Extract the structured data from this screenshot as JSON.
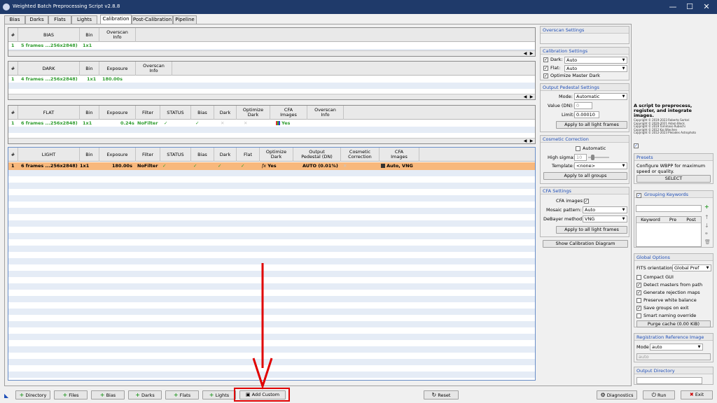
{
  "window": {
    "title": "Weighted Batch Preprocessing Script v2.8.8",
    "minimize": "—",
    "maximize": "☐",
    "close": "✕"
  },
  "tabs": [
    "Bias",
    "Darks",
    "Flats",
    "Lights",
    "Calibration",
    "Post-Calibration",
    "Pipeline"
  ],
  "active_tab": "Calibration",
  "bias_table": {
    "headers": [
      "#",
      "BIAS",
      "Bin",
      "Overscan\nInfo"
    ],
    "rows": [
      [
        "1",
        "5 frames ...256x2848)",
        "1x1",
        ""
      ]
    ]
  },
  "dark_table": {
    "headers": [
      "#",
      "DARK",
      "Bin",
      "Exposure",
      "Overscan\nInfo"
    ],
    "rows": [
      [
        "1",
        "4 frames ...256x2848)",
        "1x1",
        "180.00s",
        ""
      ]
    ]
  },
  "flat_table": {
    "headers": [
      "#",
      "FLAT",
      "Bin",
      "Exposure",
      "Filter",
      "STATUS",
      "Bias",
      "Dark",
      "Optimize\nDark",
      "CFA\nImages",
      "Overscan\nInfo"
    ],
    "rows": [
      [
        "1",
        "6 frames ...256x2848)",
        "1x1",
        "0.24s",
        "NoFilter",
        "✓",
        "✓",
        "✕",
        "✕",
        "Yes",
        ""
      ]
    ]
  },
  "light_table": {
    "headers": [
      "#",
      "LIGHT",
      "Bin",
      "Exposure",
      "Filter",
      "STATUS",
      "Bias",
      "Dark",
      "Flat",
      "Optimize\nDark",
      "Output\nPedestal (DN)",
      "Cosmetic\nCorrection",
      "CFA\nImages"
    ],
    "rows": [
      [
        "1",
        "6 frames ...256x2848)",
        "1x1",
        "180.00s",
        "NoFilter",
        "✓",
        "✓",
        "✓",
        "✓",
        "Yes",
        "AUTO (0.01%)",
        "✕",
        "Auto, VNG"
      ]
    ]
  },
  "settings": {
    "overscan_title": "Overscan Settings",
    "calibration_title": "Calibration Settings",
    "dark_label": "Dark:",
    "dark_value": "Auto",
    "flat_label": "Flat:",
    "flat_value": "Auto",
    "optimize_master_dark": "Optimize Master Dark",
    "pedestal_title": "Output Pedestal Settings",
    "mode_label": "Mode:",
    "mode_value": "Automatic",
    "value_label": "Value (DN):",
    "value_value": "0",
    "limit_label": "Limit:",
    "limit_value": "0.00010",
    "apply_light_frames": "Apply to all light frames",
    "cosmetic_title": "Cosmetic Correction",
    "automatic_label": "Automatic",
    "high_sigma_label": "High sigma:",
    "high_sigma_value": "10",
    "template_label": "Template:",
    "template_value": "<none>",
    "apply_groups": "Apply to all groups",
    "cfa_title": "CFA Settings",
    "cfa_images_label": "CFA images:",
    "mosaic_label": "Mosaic pattern:",
    "mosaic_value": "Auto",
    "debayer_label": "DeBayer method:",
    "debayer_value": "VNG",
    "apply_light_frames_2": "Apply to all light frames",
    "show_diagram": "Show Calibration Diagram"
  },
  "right": {
    "description": "A script to preprocess, register, and integrate images.",
    "copyright": [
      "Copyright © 2019-2023 Roberto Sartori",
      "Copyright © 2020-2021 Adam Block",
      "Copyright © 2019 Tommaso Rubechi",
      "Copyright © 2012 Kai Wiechen",
      "Copyright © 2012-2023 Pleiades Astrophoto"
    ],
    "presets_title": "Presets",
    "presets_text": "Configure WBPP for maximum speed or quality.",
    "select_button": "SELECT",
    "grouping_title": "Grouping Keywords",
    "kw_headers": [
      "Keyword",
      "Pre",
      "Post"
    ],
    "global_title": "Global Options",
    "fits_label": "FITS orientation:",
    "fits_value": "Global Pref",
    "options": [
      {
        "label": "Compact GUI",
        "checked": false
      },
      {
        "label": "Detect masters from path",
        "checked": true
      },
      {
        "label": "Generate rejection maps",
        "checked": true
      },
      {
        "label": "Preserve white balance",
        "checked": false
      },
      {
        "label": "Save groups on exit",
        "checked": true
      },
      {
        "label": "Smart naming override",
        "checked": false
      }
    ],
    "purge_button": "Purge cache (0.00 KiB)",
    "regref_title": "Registration Reference Image",
    "regref_mode_label": "Mode",
    "regref_mode_value": "auto",
    "regref_field": "auto",
    "output_title": "Output Directory"
  },
  "bottom": {
    "directory": "Directory",
    "files": "Files",
    "bias": "Bias",
    "darks": "Darks",
    "flats": "Flats",
    "lights": "Lights",
    "add_custom": "Add Custom",
    "reset": "Reset",
    "diagnostics": "Diagnostics",
    "run": "Run",
    "exit": "Exit"
  },
  "colors": {
    "title_bar": "#1f3a6a",
    "group_title": "#1f4fb8",
    "row_alt": "#e5ecf6",
    "selected_row": "#f8b87c",
    "highlight": "#e00000",
    "green_text": "#2e9c2e"
  }
}
